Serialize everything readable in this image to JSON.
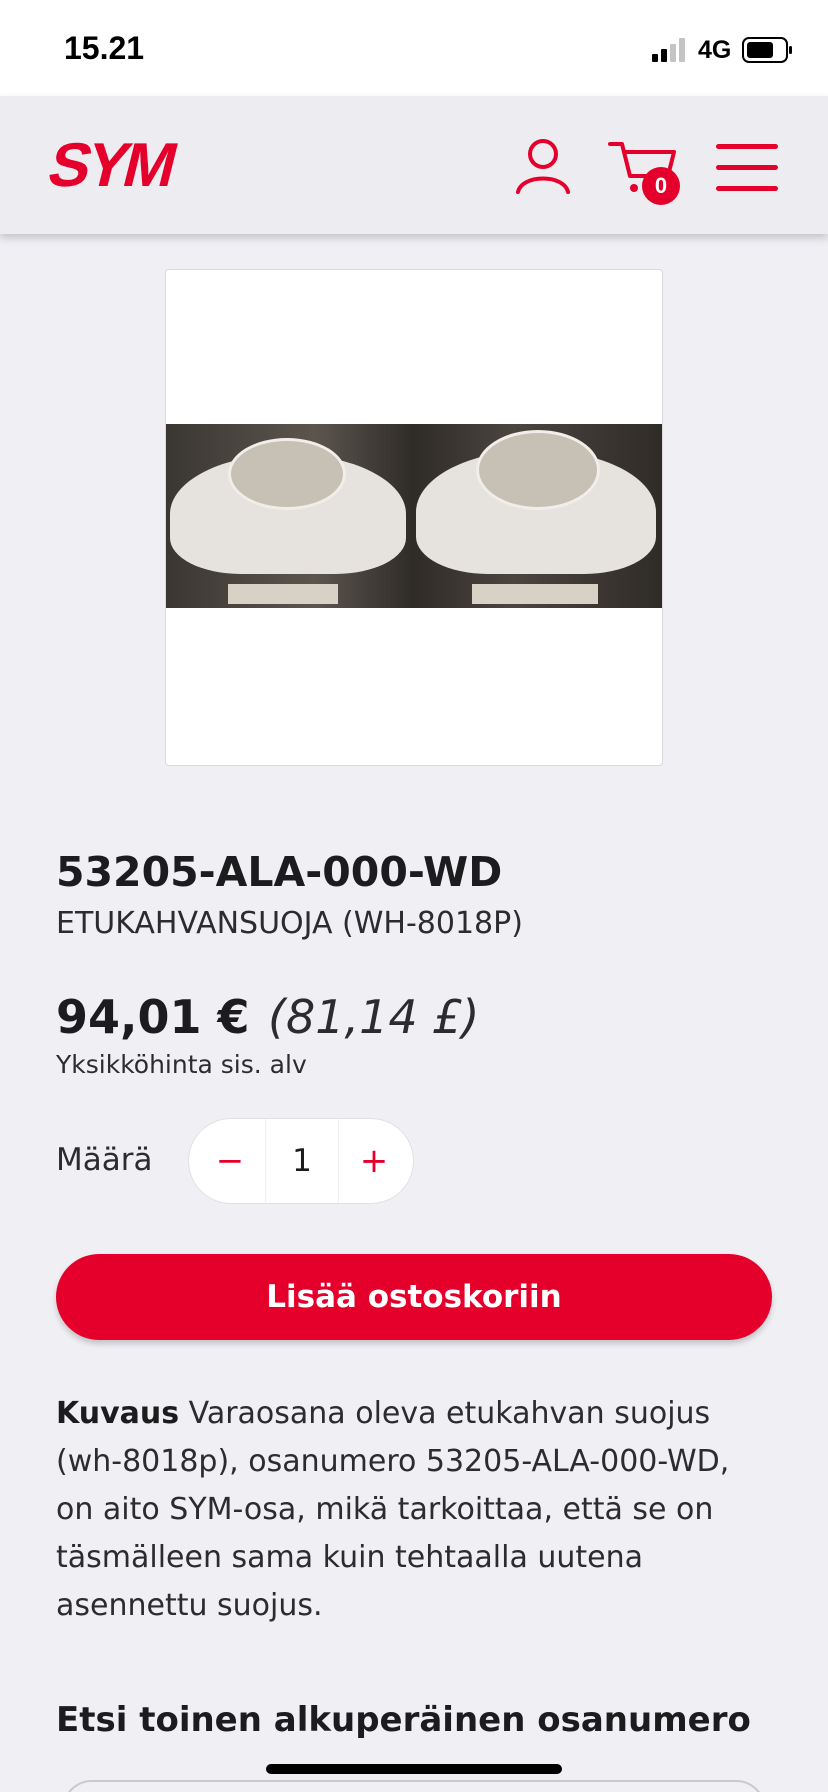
{
  "status_bar": {
    "time": "15.21",
    "network": "4G"
  },
  "header": {
    "logo_text": "SYM",
    "cart_count": "0",
    "icons": [
      "user-icon",
      "cart-icon",
      "menu-icon"
    ],
    "accent_color": "#e4002b"
  },
  "product": {
    "image_alt": "product-photo",
    "sku": "53205-ALA-000-WD",
    "name": "ETUKAHVANSUOJA (WH-8018P)",
    "price": "94,01 €",
    "price_gbp": "(81,14 £)",
    "price_note": "Yksikköhinta sis. alv"
  },
  "quantity": {
    "label": "Määrä",
    "value": "1",
    "minus": "−",
    "plus": "+"
  },
  "add_to_cart_label": "Lisää ostoskoriin",
  "description": {
    "label": "Kuvaus",
    "text": " Varaosana oleva etukahvan suojus (wh-8018p), osanumero 53205-ALA-000-WD, on aito SYM-osa, mikä tarkoittaa, että se on täsmälleen sama kuin tehtaalla uutena asennettu suojus."
  },
  "search_heading": "Etsi toinen alkuperäinen osanumero"
}
